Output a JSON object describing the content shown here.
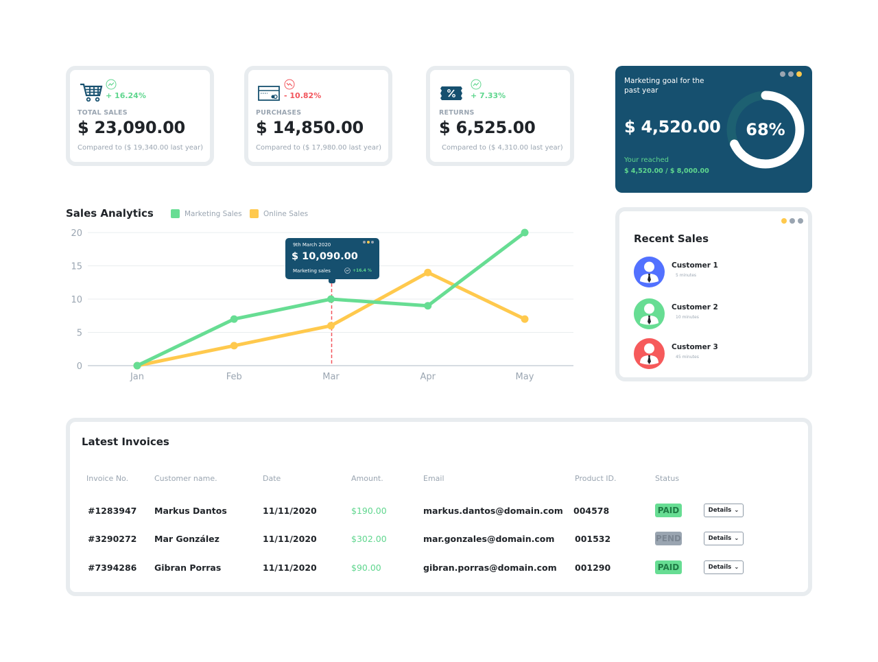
{
  "colors": {
    "accent_dark": "#16506f",
    "green": "#5fd68e",
    "red": "#f2545b",
    "yellow": "#ffc94d",
    "muted": "#9aa5b1",
    "pending": "#9aa5b1"
  },
  "stats": [
    {
      "icon": "shopping-cart-icon",
      "trend": "up",
      "change": "+ 16.24%",
      "label": "TOTAL SALES",
      "value": "$ 23,090.00",
      "compare": "Compared to ($ 19,340.00 last year)"
    },
    {
      "icon": "credit-card-icon",
      "trend": "down",
      "change": "- 10.82%",
      "label": "PURCHASES",
      "value": "$ 14,850.00",
      "compare": "Compared to ($ 17,980.00 last year)"
    },
    {
      "icon": "coupon-icon",
      "trend": "up",
      "change": "+ 7.33%",
      "label": "RETURNS",
      "value": "$ 6,525.00",
      "compare": "Compared to ($ 4,310.00 last year)"
    }
  ],
  "goal": {
    "title": "Marketing goal for the past year",
    "value": "$ 4,520.00",
    "percent_label": "68%",
    "progress": 0.68,
    "reached_label": "Your reached",
    "reached_value": "$ 4,520.00 / $ 8,000.00"
  },
  "chart_data": {
    "type": "line",
    "title": "Sales Analytics",
    "categories": [
      "Jan",
      "Feb",
      "Mar",
      "Apr",
      "May"
    ],
    "series": [
      {
        "name": "Marketing Sales",
        "color": "#67dd93",
        "values": [
          0,
          7,
          10,
          9,
          20
        ]
      },
      {
        "name": "Online Sales",
        "color": "#ffc94d",
        "values": [
          0,
          3,
          6,
          14,
          7
        ]
      }
    ],
    "yticks": [
      0,
      5,
      10,
      15,
      20
    ],
    "ylim": [
      0,
      20
    ],
    "xlabel": "",
    "ylabel": "",
    "grid": true,
    "legend": "top",
    "marker_category": "Mar",
    "tooltip": {
      "date": "9th March 2020",
      "value": "$ 10,090.00",
      "label": "Marketing sales",
      "change": "+16.4 %"
    }
  },
  "recent_sales": {
    "title": "Recent Sales",
    "customers": [
      {
        "name": "Customer 1",
        "time": "5 minutes",
        "color": "#5271ff"
      },
      {
        "name": "Customer 2",
        "time": "10 minutes",
        "color": "#67dd93"
      },
      {
        "name": "Customer 3",
        "time": "45 minutes",
        "color": "#f65a5b"
      }
    ]
  },
  "invoices": {
    "title": "Latest Invoices",
    "columns": [
      "Invoice No.",
      "Customer name.",
      "Date",
      "Amount.",
      "Email",
      "Product ID.",
      "Status"
    ],
    "details_label": "Details",
    "rows": [
      {
        "invoice": "#1283947",
        "customer": "Markus Dantos",
        "date": "11/11/2020",
        "amount": "$190.00",
        "email": "markus.dantos@domain.com",
        "product": "004578",
        "status": "PAID"
      },
      {
        "invoice": "#3290272",
        "customer": "Mar González",
        "date": "11/11/2020",
        "amount": "$302.00",
        "email": "mar.gonzales@domain.com",
        "product": "001532",
        "status": "PEND"
      },
      {
        "invoice": "#7394286",
        "customer": "Gibran Porras",
        "date": "11/11/2020",
        "amount": "$90.00",
        "email": "gibran.porras@domain.com",
        "product": "001290",
        "status": "PAID"
      }
    ]
  }
}
